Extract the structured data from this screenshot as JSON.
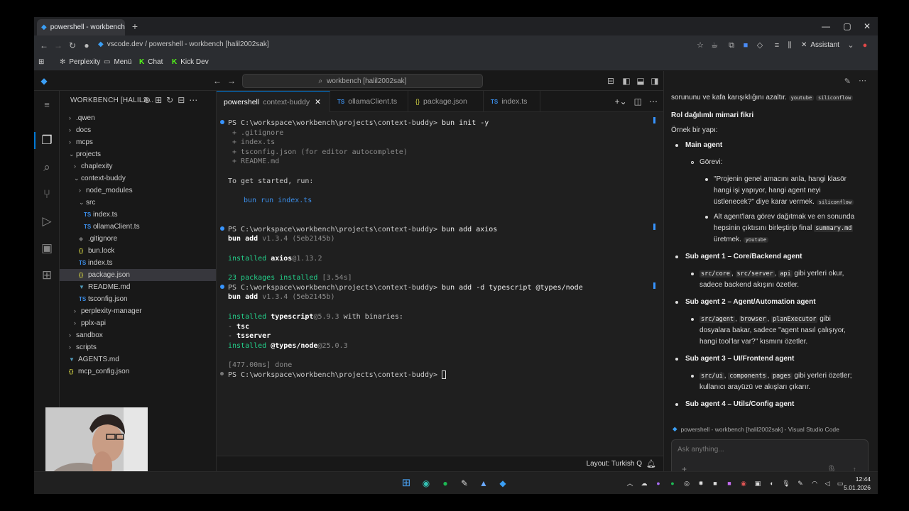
{
  "browser": {
    "tab_title": "powershell - workbench [halil...",
    "url": "vscode.dev / powershell - workbench [halil2002sak]",
    "assistant_label": "Assistant",
    "bookmarks": [
      "Perplexity",
      "Menü",
      "Chat",
      "Kick Dev"
    ]
  },
  "vscode": {
    "command_center": "workbench [halil2002sak]",
    "explorer_title": "WORKBENCH [HALIL2...",
    "tree": [
      {
        "label": ".qwen",
        "kind": "folder",
        "depth": 1,
        "open": false
      },
      {
        "label": "docs",
        "kind": "folder",
        "depth": 1,
        "open": false
      },
      {
        "label": "mcps",
        "kind": "folder",
        "depth": 1,
        "open": false
      },
      {
        "label": "projects",
        "kind": "folder",
        "depth": 1,
        "open": true
      },
      {
        "label": "chaplexity",
        "kind": "folder",
        "depth": 2,
        "open": false
      },
      {
        "label": "context-buddy",
        "kind": "folder",
        "depth": 2,
        "open": true
      },
      {
        "label": "node_modules",
        "kind": "folder",
        "depth": 3,
        "open": false
      },
      {
        "label": "src",
        "kind": "folder",
        "depth": 3,
        "open": true
      },
      {
        "label": "index.ts",
        "kind": "ts",
        "depth": 4
      },
      {
        "label": "ollamaClient.ts",
        "kind": "ts",
        "depth": 4
      },
      {
        "label": ".gitignore",
        "kind": "git",
        "depth": 3
      },
      {
        "label": "bun.lock",
        "kind": "lock",
        "depth": 3
      },
      {
        "label": "index.ts",
        "kind": "ts",
        "depth": 3
      },
      {
        "label": "package.json",
        "kind": "json",
        "depth": 3,
        "selected": true
      },
      {
        "label": "README.md",
        "kind": "md",
        "depth": 3
      },
      {
        "label": "tsconfig.json",
        "kind": "ts",
        "depth": 3
      },
      {
        "label": "perplexity-manager",
        "kind": "folder",
        "depth": 2,
        "open": false
      },
      {
        "label": "pplx-api",
        "kind": "folder",
        "depth": 2,
        "open": false
      },
      {
        "label": "sandbox",
        "kind": "folder",
        "depth": 1,
        "open": false
      },
      {
        "label": "scripts",
        "kind": "folder",
        "depth": 1,
        "open": false
      },
      {
        "label": "AGENTS.md",
        "kind": "md",
        "depth": 1
      },
      {
        "label": "mcp_config.json",
        "kind": "json",
        "depth": 1
      }
    ],
    "tabs": [
      {
        "label": "powershell",
        "detail": "context-buddy",
        "active": true
      },
      {
        "label": "ollamaClient.ts",
        "kind": "TS"
      },
      {
        "label": "package.json",
        "kind": "{}"
      },
      {
        "label": "index.ts",
        "kind": "TS"
      }
    ],
    "terminal": {
      "prompt": "PS C:\\workspace\\workbench\\projects\\context-buddy>",
      "cmd1": "bun init -y",
      "created": [
        "+ .gitignore",
        "+ index.ts",
        "+ tsconfig.json (for editor autocomplete)",
        "+ README.md"
      ],
      "get_started": "To get started, run:",
      "run_cmd": "bun run index.ts",
      "cmd2": "bun add axios",
      "bun_add": "bun add",
      "bun_version": "v1.3.4 (5eb2145b)",
      "installed": "installed",
      "axios": "axios",
      "axios_ver": "@1.13.2",
      "packages": "23 packages installed",
      "packages_time": "[3.54s]",
      "cmd3": "bun add -d typescript @types/node",
      "typescript": "typescript",
      "ts_ver": "@5.9.3",
      "with_binaries": "with binaries:",
      "bin1": "tsc",
      "bin2": "tsserver",
      "types_node": "@types/node",
      "types_ver": "@25.0.3",
      "done_time": "[477.00ms]",
      "done": "done"
    },
    "status": {
      "layout": "Layout: Turkish Q"
    }
  },
  "assistant": {
    "line0": "sorununu ve kafa karışıklığını azaltır.",
    "tag_youtube": "youtube",
    "tag_siliconflow": "siliconflow",
    "heading1": "Rol dağılımlı mimari fikri",
    "example": "Örnek bir yapı:",
    "main_agent": "Main agent",
    "gorevi": "Görevi:",
    "g1a": "\"Projenin genel amacını anla, hangi klasör",
    "g1b": "hangi işi yapıyor, hangi agent neyi",
    "g1c": "üstlenecek?\" diye karar vermek.",
    "g2a": "Alt agent'lara görev dağıtmak ve en sonunda",
    "g2b": "hepsinin çıktısını birleştirip final",
    "g2code": "summary.md",
    "g2c": "üretmek.",
    "sub1": "Sub agent 1 – Core/Backend agent",
    "s1code1": "src/core",
    "s1code2": "src/server",
    "s1code3": "api",
    "s1a": "gibi yerleri okur,",
    "s1b": "sadece backend akışını özetler.",
    "sub2": "Sub agent 2 – Agent/Automation agent",
    "s2code1": "src/agent",
    "s2code2": "browser",
    "s2code3": "planExecutor",
    "s2a": "gibi",
    "s2b": "dosyalara bakar, sadece \"agent nasıl çalışıyor,",
    "s2c": "hangi tool'lar var?\" kısmını özetler.",
    "sub3": "Sub agent 3 – UI/Frontend agent",
    "s3code1": "src/ui",
    "s3code2": "components",
    "s3code3": "pages",
    "s3a": "gibi yerleri özetler;",
    "s3b": "kullanıcı arayüzü ve akışları çıkarır.",
    "sub4": "Sub agent 4 – Utils/Config agent",
    "context": "powershell - workbench [halil2002sak] - Visual Studio Code",
    "placeholder": "Ask anything..."
  },
  "taskbar": {
    "time": "12:44",
    "date": "5.01.2026"
  }
}
